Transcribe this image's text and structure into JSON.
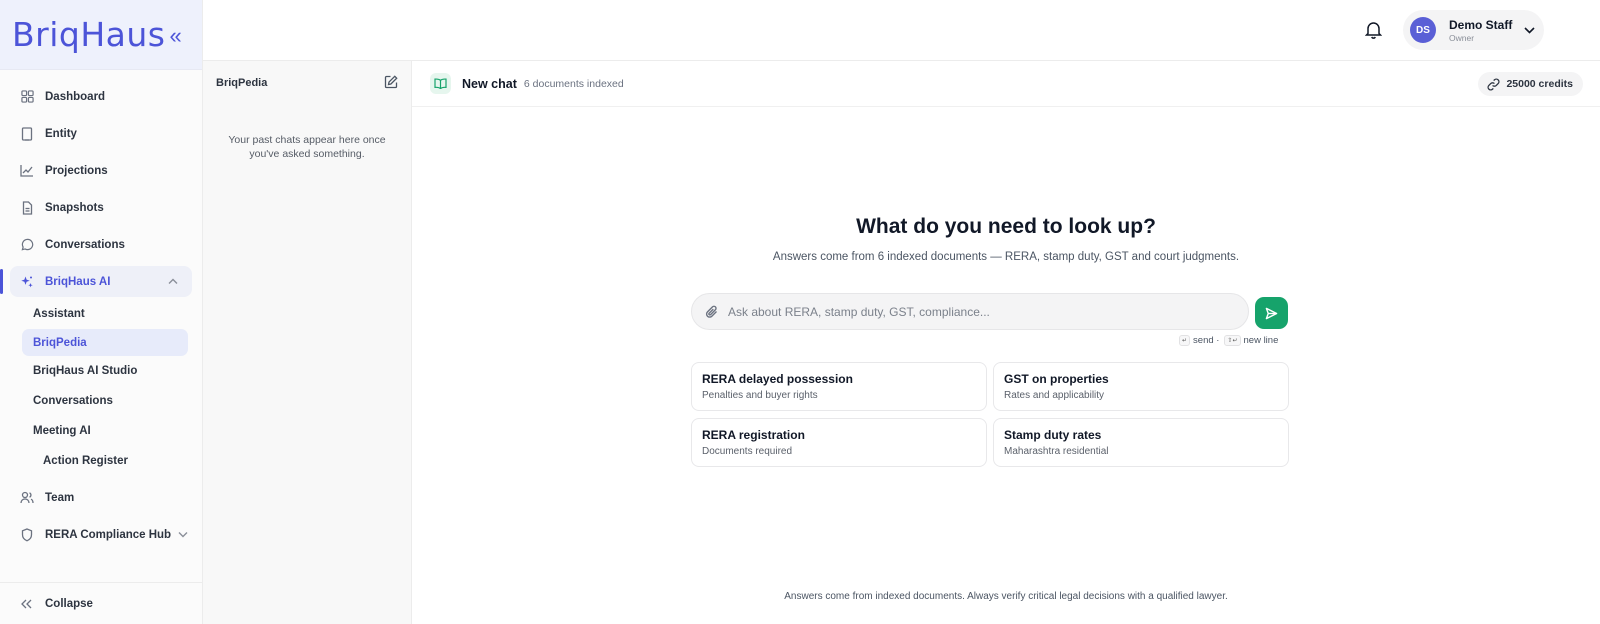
{
  "brand": {
    "logo_text": "BriqHaus",
    "collapse_glyph": "«",
    "accent": "#4c54d8"
  },
  "sidebar": {
    "items": [
      {
        "label": "Dashboard",
        "icon": "grid-icon"
      },
      {
        "label": "Entity",
        "icon": "building-icon"
      },
      {
        "label": "Projections",
        "icon": "chart-line-icon"
      },
      {
        "label": "Snapshots",
        "icon": "file-icon"
      },
      {
        "label": "Conversations",
        "icon": "chat-bubble-icon"
      }
    ],
    "ai_group": {
      "label": "BriqHaus AI",
      "icon": "sparkles-icon",
      "children": [
        {
          "label": "Assistant"
        },
        {
          "label": "BriqPedia"
        },
        {
          "label": "BriqHaus AI Studio"
        },
        {
          "label": "Conversations"
        },
        {
          "label": "Meeting AI"
        },
        {
          "label": "Action Register"
        }
      ]
    },
    "team": {
      "label": "Team",
      "icon": "users-icon"
    },
    "rera": {
      "label": "RERA Compliance Hub",
      "icon": "shield-icon"
    },
    "collapse_label": "Collapse"
  },
  "header": {
    "user": {
      "initials": "DS",
      "name": "Demo Staff",
      "role": "Owner"
    }
  },
  "history": {
    "title": "BriqPedia",
    "empty_text": "Your past chats appear here once you've asked something."
  },
  "chat": {
    "title": "New chat",
    "docs_indexed": "6 documents indexed",
    "credits": "25000 credits",
    "hero_title": "What do you need to look up?",
    "hero_sub": "Answers come from 6 indexed documents — RERA, stamp duty, GST and court judgments.",
    "input_placeholder": "Ask about RERA, stamp duty, GST, compliance...",
    "hint_send": "send ·",
    "hint_newline": "new line",
    "send_color": "#16a36b",
    "suggestions": [
      {
        "title": "RERA delayed possession",
        "subtitle": "Penalties and buyer rights"
      },
      {
        "title": "GST on properties",
        "subtitle": "Rates and applicability"
      },
      {
        "title": "RERA registration",
        "subtitle": "Documents required"
      },
      {
        "title": "Stamp duty rates",
        "subtitle": "Maharashtra residential"
      }
    ],
    "disclaimer": "Answers come from indexed documents. Always verify critical legal decisions with a qualified lawyer."
  }
}
